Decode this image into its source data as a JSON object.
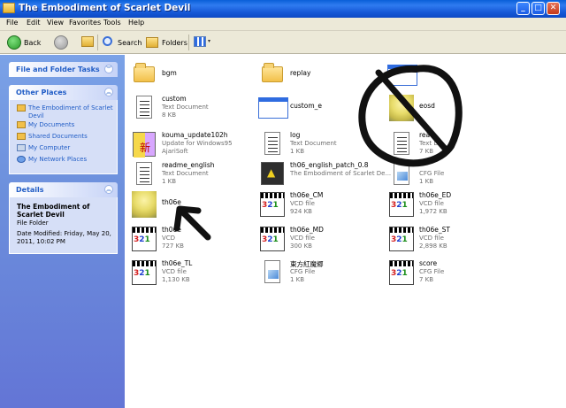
{
  "window": {
    "title": "The Embodiment of Scarlet Devil",
    "controls": {
      "minimize": "_",
      "maximize": "□",
      "close": "✕"
    }
  },
  "menu": [
    "File",
    "Edit",
    "View",
    "Favorites",
    "Tools",
    "Help"
  ],
  "toolbar": {
    "back": "Back",
    "search": "Search",
    "folders": "Folders"
  },
  "taskpane": {
    "file_tasks": {
      "title": "File and Folder Tasks"
    },
    "other_places": {
      "title": "Other Places",
      "links": [
        {
          "label": "The Embodiment of Scarlet Devil",
          "icon": "folder-icon"
        },
        {
          "label": "My Documents",
          "icon": "my-documents-icon"
        },
        {
          "label": "Shared Documents",
          "icon": "shared-documents-icon"
        },
        {
          "label": "My Computer",
          "icon": "my-computer-icon"
        },
        {
          "label": "My Network Places",
          "icon": "network-icon"
        }
      ]
    },
    "details": {
      "title": "Details",
      "name": "The Embodiment of Scarlet Devil",
      "type": "File Folder",
      "modified": "Date Modified: Friday, May 20, 2011, 10:02 PM"
    }
  },
  "files": [
    {
      "name": "bgm",
      "type": "",
      "size": "",
      "icon": "folder"
    },
    {
      "name": "replay",
      "type": "",
      "size": "",
      "icon": "folder"
    },
    {
      "name": "",
      "type": "",
      "size": "",
      "icon": "window"
    },
    {
      "name": "custom",
      "type": "Text Document",
      "size": "8 KB",
      "icon": "doc"
    },
    {
      "name": "custom_e",
      "type": "",
      "size": "",
      "icon": "window"
    },
    {
      "name": "eosd",
      "type": "",
      "size": "",
      "icon": "anime"
    },
    {
      "name": "kouma_update102h",
      "type": "Update for Windows95",
      "size": "AjariSoft",
      "icon": "kouma"
    },
    {
      "name": "log",
      "type": "Text Document",
      "size": "1 KB",
      "icon": "doc"
    },
    {
      "name": "rea",
      "type": "Text D",
      "size": "7 KB",
      "icon": "doc"
    },
    {
      "name": "readme_english",
      "type": "Text Document",
      "size": "1 KB",
      "icon": "doc"
    },
    {
      "name": "th06_english_patch_0.8",
      "type": "The Embodiment of Scarlet De...",
      "size": "",
      "icon": "patch"
    },
    {
      "name": "",
      "type": "CFG File",
      "size": "1 KB",
      "icon": "cfg"
    },
    {
      "name": "th06e",
      "type": "",
      "size": "",
      "icon": "anime"
    },
    {
      "name": "th06e_CM",
      "type": "VCD file",
      "size": "924 KB",
      "icon": "vcd"
    },
    {
      "name": "th06e_ED",
      "type": "VCD file",
      "size": "1,972 KB",
      "icon": "vcd"
    },
    {
      "name": "th06e",
      "type": "VCD",
      "size": "727 KB",
      "icon": "vcd"
    },
    {
      "name": "th06e_MD",
      "type": "VCD file",
      "size": "300 KB",
      "icon": "vcd"
    },
    {
      "name": "th06e_ST",
      "type": "VCD file",
      "size": "2,898 KB",
      "icon": "vcd"
    },
    {
      "name": "th06e_TL",
      "type": "VCD file",
      "size": "1,130 KB",
      "icon": "vcd"
    },
    {
      "name": "東方紅魔郷",
      "type": "CFG File",
      "size": "1 KB",
      "icon": "cfg"
    },
    {
      "name": "score",
      "type": "CFG File",
      "size": "7 KB",
      "icon": "vcd"
    }
  ]
}
